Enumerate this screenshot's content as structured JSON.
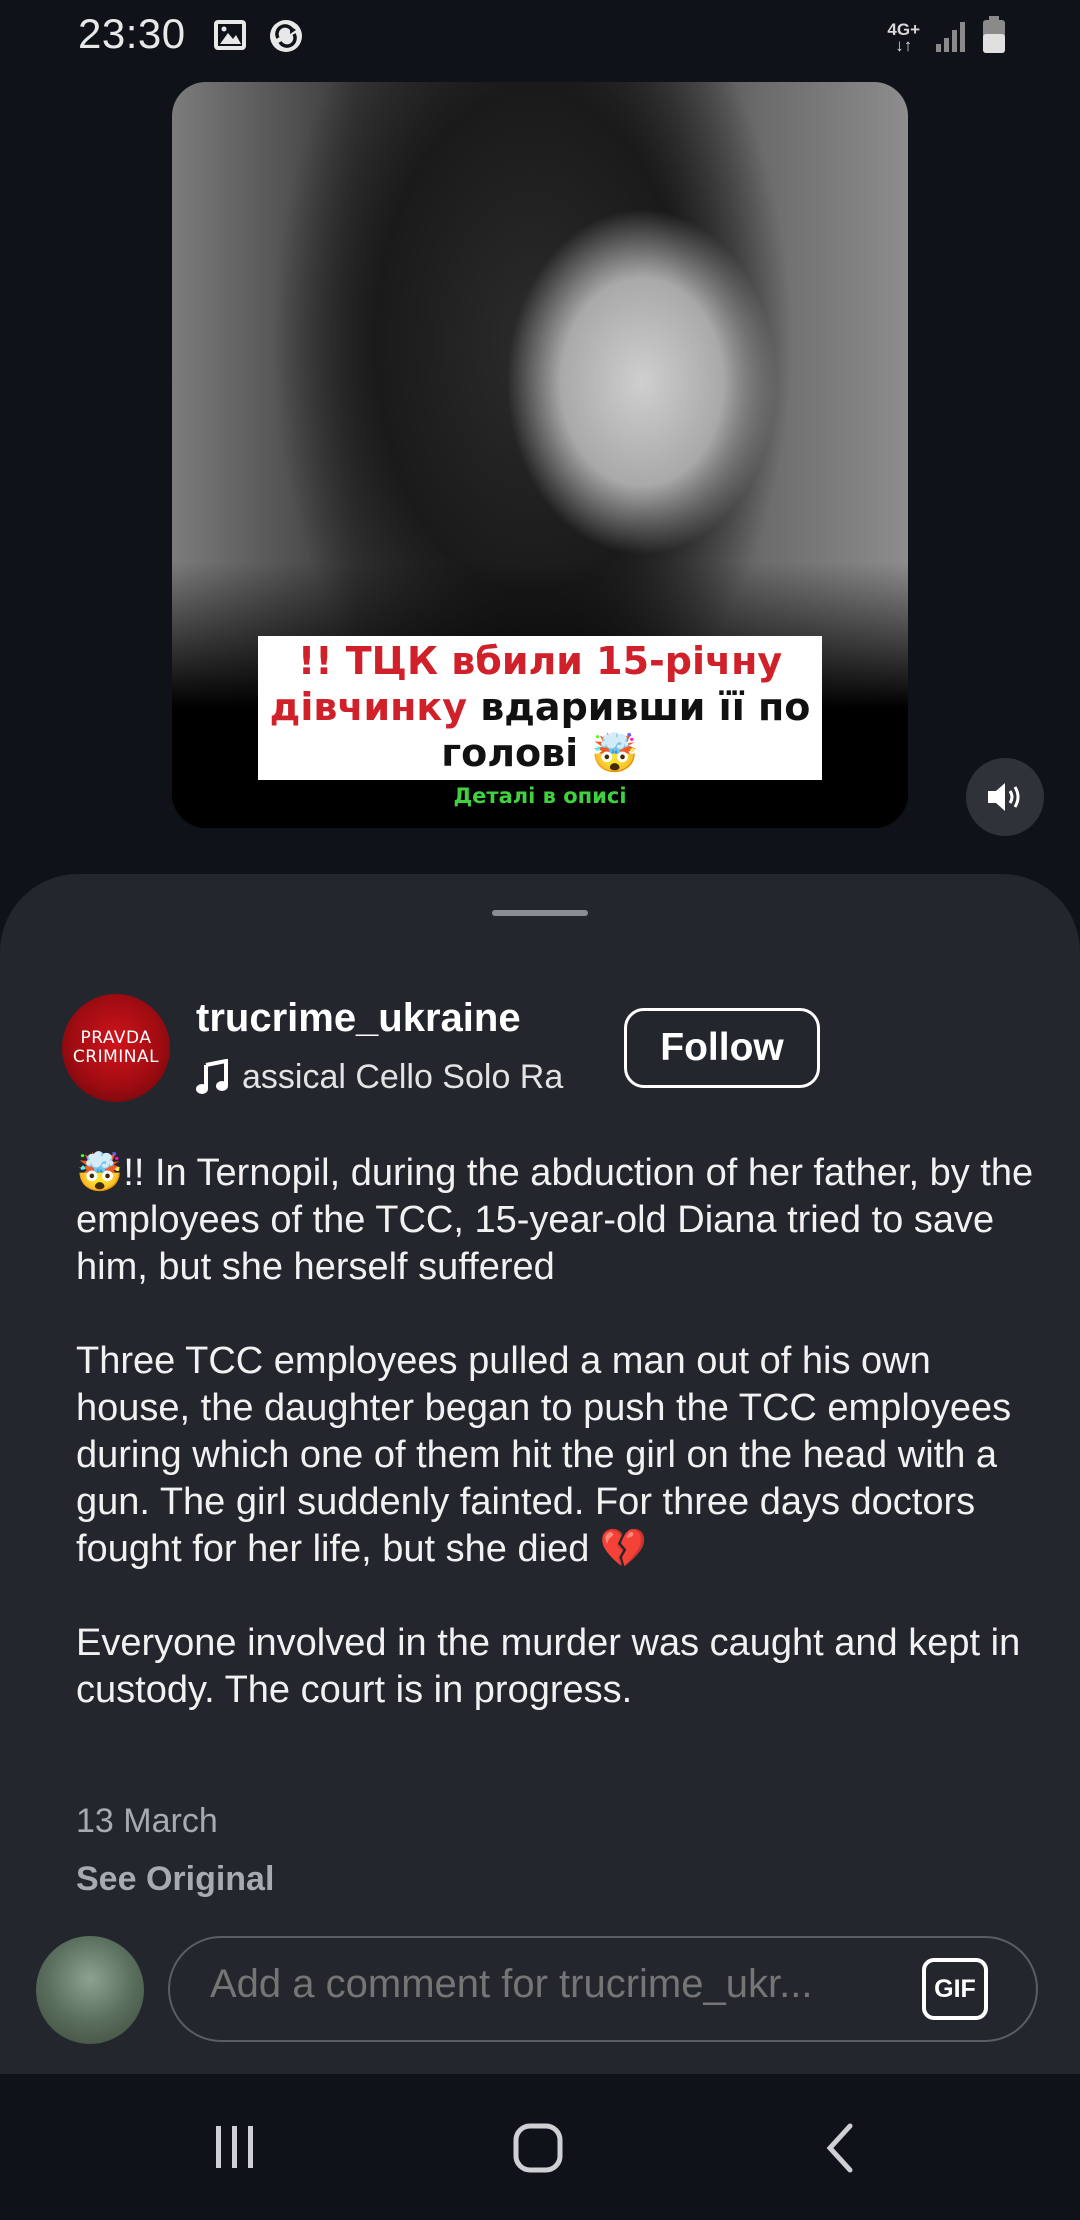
{
  "status_bar": {
    "time": "23:30",
    "network": "4G+",
    "icons": [
      "image-icon",
      "sync-icon",
      "signal-icon",
      "battery-icon"
    ]
  },
  "video": {
    "caption_part1": "!! ТЦК ",
    "caption_part2": "вбили 15-річну дівчинку",
    "caption_part3": " вдаривши її по голові 🤯",
    "caption_sub": "Деталі в описі",
    "sound_icon": "volume-icon"
  },
  "post": {
    "avatar_line1": "PRAVDA",
    "avatar_line2": "CRIMINAL",
    "username": "trucrime_ukraine",
    "music": "assical Cello Solo    Ra",
    "follow_label": "Follow",
    "paragraph1": "🤯!!  In Ternopil, during the abduction of her father, by the employees of the TCC, 15-year-old Diana tried to save him, but she herself suffered",
    "paragraph2": "Three TCC employees pulled a man out of his own house, the daughter began to push the TCC employees during which one of them hit the girl on the head with a gun. The girl suddenly fainted. For three days doctors fought for her life, but she died 💔",
    "paragraph3": "Everyone involved in the murder was caught and kept in custody. The court is in progress.",
    "date": "13 March",
    "see_original": "See Original"
  },
  "comment": {
    "placeholder": "Add a comment for trucrime_ukr...",
    "gif_label": "GIF"
  },
  "nav": {
    "icons": [
      "recent-apps-icon",
      "home-icon",
      "back-icon"
    ]
  },
  "colors": {
    "background": "#0f1319",
    "sheet": "#23262d",
    "accent_red": "#d0202a",
    "accent_green": "#3fd13f"
  }
}
